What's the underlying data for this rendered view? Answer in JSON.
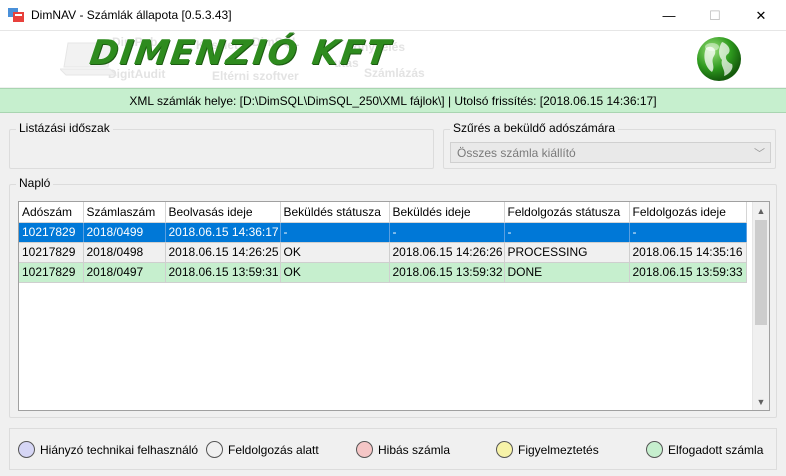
{
  "window": {
    "title": "DimNAV - Számlák állapota [0.5.3.43]",
    "minimize": "—",
    "maximize": "☐",
    "close": "✕"
  },
  "banner": {
    "logo": "DIMENZIÓ KFT",
    "ghost_words": [
      "DimPub",
      "Készlet",
      "DimSQL",
      "Könyvelés",
      "DigitAudit",
      "Eltérni szoftver",
      "Számlázás",
      "utás"
    ],
    "globe_icon": "globe-icon"
  },
  "status": {
    "text": "XML számlák helye: [D:\\DimSQL\\DimSQL_250\\XML fájlok\\] | Utolsó frissítés: [2018.06.15 14:36:17]"
  },
  "date_group": {
    "label": "Listázási időszak"
  },
  "filter_group": {
    "label": "Szűrés a beküldő adószámára",
    "selected": "Összes számla kiállító",
    "arrow": "﹀"
  },
  "log": {
    "label": "Napló",
    "columns": [
      "Adószám",
      "Számlaszám",
      "Beolvasás ideje",
      "Beküldés státusza",
      "Beküldés ideje",
      "Feldolgozás státusza",
      "Feldolgozás ideje"
    ],
    "rows": [
      [
        "10217829",
        "2018/0499",
        "2018.06.15 14:36:17",
        "-",
        "-",
        "-",
        "-"
      ],
      [
        "10217829",
        "2018/0498",
        "2018.06.15 14:26:25",
        "OK",
        "2018.06.15 14:26:26",
        "PROCESSING",
        "2018.06.15 14:35:16"
      ],
      [
        "10217829",
        "2018/0497",
        "2018.06.15 13:59:31",
        "OK",
        "2018.06.15 13:59:32",
        "DONE",
        "2018.06.15 13:59:33"
      ]
    ],
    "scroll_up": "▲",
    "scroll_down": "▼"
  },
  "legend": [
    {
      "label": "Hiányzó technikai felhasználó",
      "color": "#d6d6f5"
    },
    {
      "label": "Feldolgozás alatt",
      "color": "#f0f0f0"
    },
    {
      "label": "Hibás számla",
      "color": "#f5c6c6"
    },
    {
      "label": "Figyelmeztetés",
      "color": "#f7f3a8"
    },
    {
      "label": "Elfogadott számla",
      "color": "#c6efce"
    }
  ]
}
